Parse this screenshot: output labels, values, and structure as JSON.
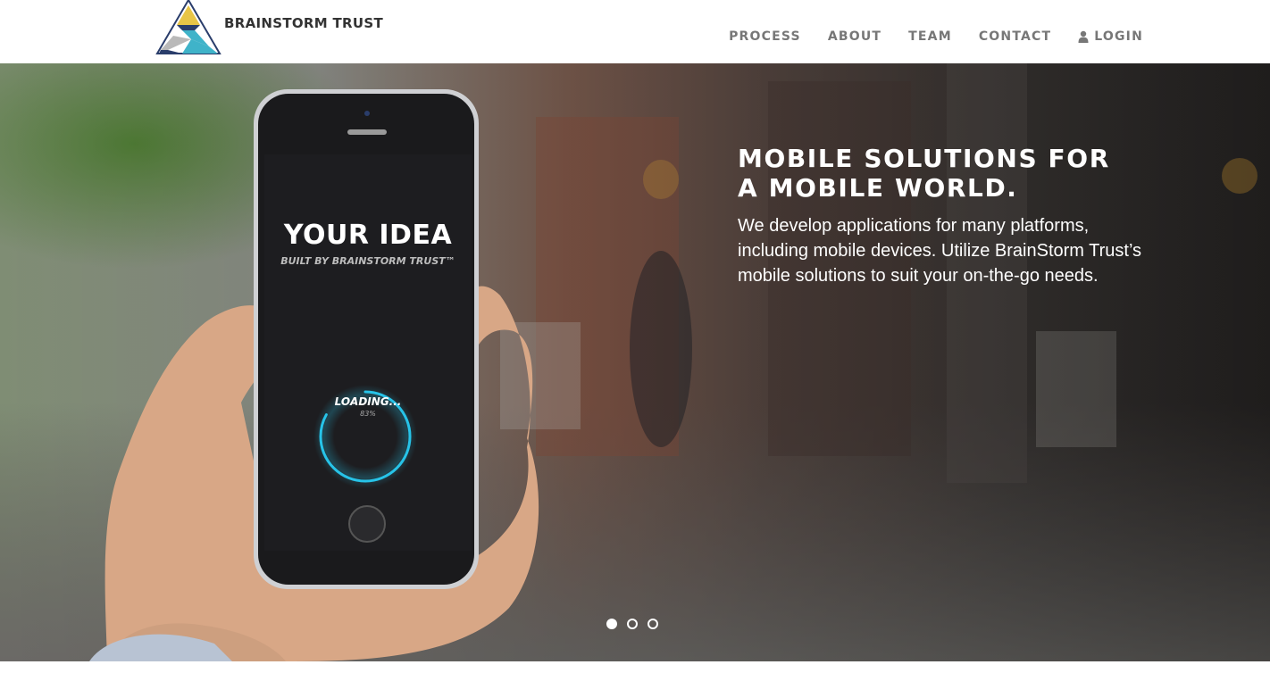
{
  "brand": {
    "name": "BRAINSTORM TRUST",
    "logo_icon": "triangle-mountain-logo",
    "colors": {
      "yellow": "#e8c547",
      "blue": "#2a3d6b",
      "teal": "#3fb3c9",
      "gray": "#b9b9b9"
    }
  },
  "nav": {
    "items": [
      {
        "label": "PROCESS"
      },
      {
        "label": "ABOUT"
      },
      {
        "label": "TEAM"
      },
      {
        "label": "CONTACT"
      },
      {
        "label": "LOGIN",
        "icon": "user-icon"
      }
    ],
    "color": "#777777"
  },
  "hero": {
    "title_line1": "MOBILE SOLUTIONS FOR",
    "title_line2": "A MOBILE WORLD.",
    "description": "We develop applications for many platforms, including mobile devices. Utilize BrainStorm Trust’s mobile solutions to suit your on-the-go needs.",
    "phone_screen": {
      "headline": "YOUR IDEA",
      "subline": "BUILT BY BRAINSTORM TRUST™",
      "loading_label": "LOADING...",
      "loading_percent": "83%",
      "progress": 0.83,
      "ring_color": "#27c3e8"
    }
  },
  "carousel": {
    "slide_count": 3,
    "active_index": 0
  }
}
